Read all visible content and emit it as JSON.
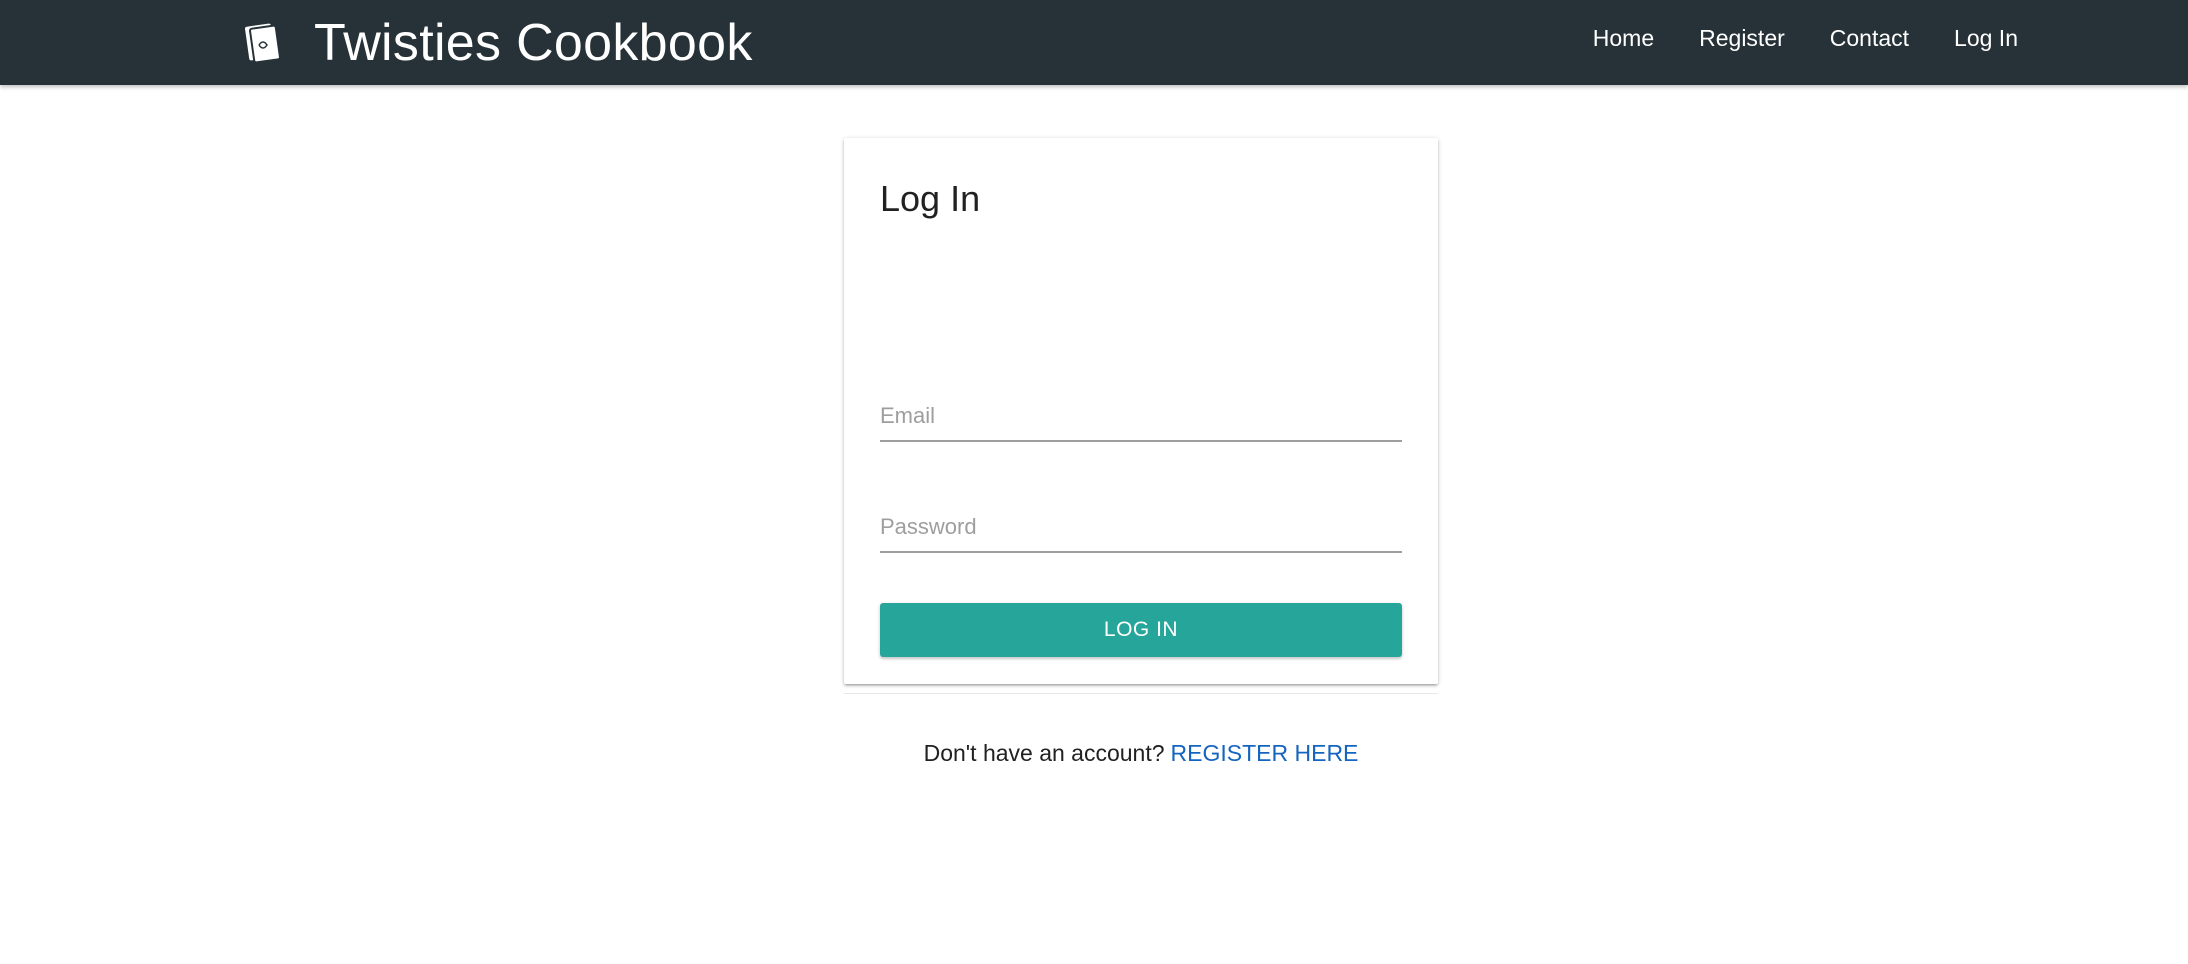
{
  "navbar": {
    "brand_title": "Twisties Cookbook",
    "brand_icon": "cookbook-icon",
    "links": [
      "Home",
      "Register",
      "Contact",
      "Log In"
    ]
  },
  "login_card": {
    "title": "Log In",
    "email_placeholder": "Email",
    "email_value": "",
    "password_placeholder": "Password",
    "password_value": "",
    "submit_label": "LOG IN",
    "register_prompt": "Don't have an account?",
    "register_link": "REGISTER HERE"
  },
  "colors": {
    "navbar_bg": "#263238",
    "button_bg": "#26a69a",
    "link": "#1565c0"
  }
}
